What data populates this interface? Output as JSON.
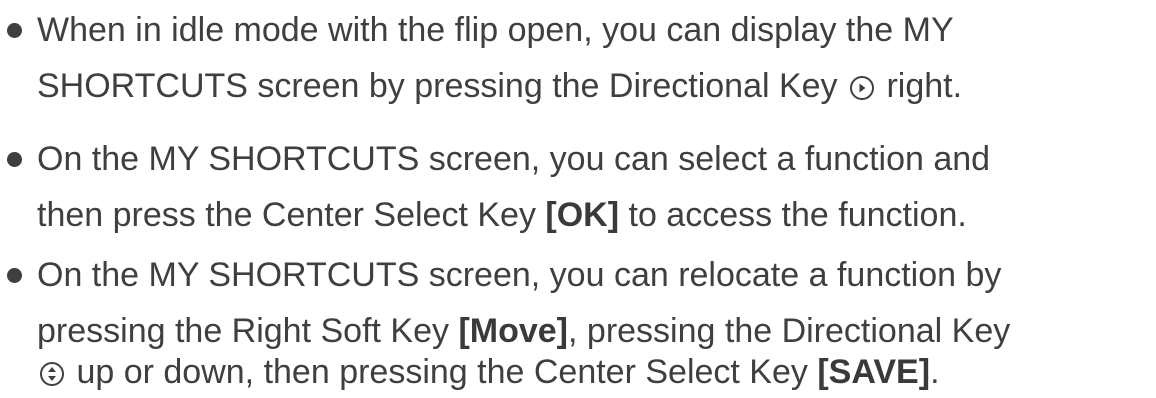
{
  "bullets": [
    {
      "line1": "When in idle mode with the flip open, you can display the MY",
      "line2_a": "SHORTCUTS screen by pressing the Directional Key",
      "line2_b": "right.",
      "icon": "directional-key-right-icon"
    },
    {
      "line1": "On the MY SHORTCUTS screen, you can select a function and",
      "line2_a": "then press the Center Select Key ",
      "line2_bold": "[OK]",
      "line2_b": " to access the function."
    },
    {
      "line1_a": "On the MY SHORTCUTS screen, you can relocate a function by",
      "line2_a": "pressing the Right Soft Key ",
      "line2_bold": "[Move]",
      "line2_b": ", pressing the Directional Key",
      "line3_a": "up or down, then pressing the Center Select Key ",
      "line3_bold": "[SAVE]",
      "line3_b": ".",
      "icon": "directional-key-up-down-icon"
    }
  ],
  "colors": {
    "text": "#3f3f3f"
  }
}
